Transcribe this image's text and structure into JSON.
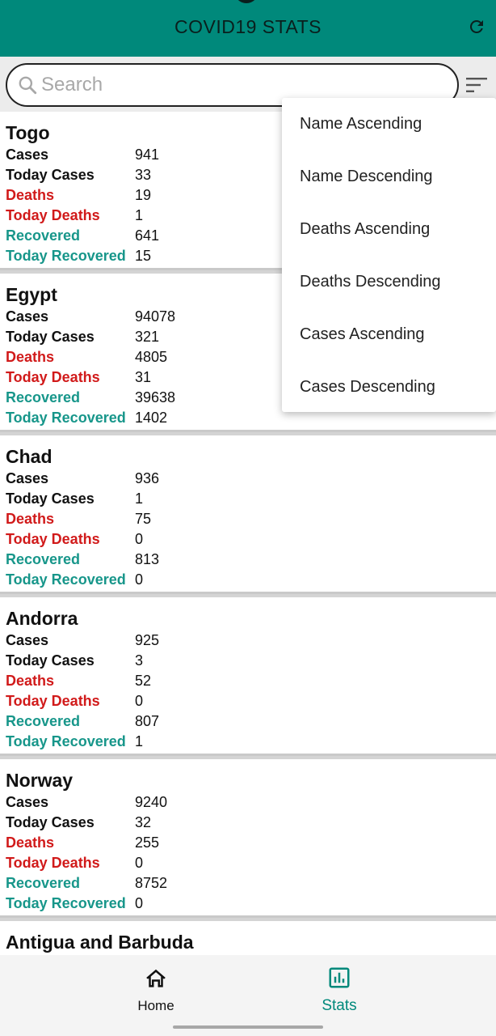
{
  "app": {
    "title": "COVID19 STATS"
  },
  "search": {
    "placeholder": "Search",
    "value": ""
  },
  "labels": {
    "cases": "Cases",
    "today_cases": "Today Cases",
    "deaths": "Deaths",
    "today_deaths": "Today Deaths",
    "recovered": "Recovered",
    "today_recovered": "Today Recovered"
  },
  "countries": [
    {
      "name": "Togo",
      "cases": "941",
      "today_cases": "33",
      "deaths": "19",
      "today_deaths": "1",
      "recovered": "641",
      "today_recovered": "15"
    },
    {
      "name": "Egypt",
      "cases": "94078",
      "today_cases": "321",
      "deaths": "4805",
      "today_deaths": "31",
      "recovered": "39638",
      "today_recovered": "1402"
    },
    {
      "name": "Chad",
      "cases": "936",
      "today_cases": "1",
      "deaths": "75",
      "today_deaths": "0",
      "recovered": "813",
      "today_recovered": "0"
    },
    {
      "name": "Andorra",
      "cases": "925",
      "today_cases": "3",
      "deaths": "52",
      "today_deaths": "0",
      "recovered": "807",
      "today_recovered": "1"
    },
    {
      "name": "Norway",
      "cases": "9240",
      "today_cases": "32",
      "deaths": "255",
      "today_deaths": "0",
      "recovered": "8752",
      "today_recovered": "0"
    },
    {
      "name": "Antigua and Barbuda"
    }
  ],
  "sort_menu": [
    "Name Ascending",
    "Name Descending",
    "Deaths Ascending",
    "Deaths Descending",
    "Cases Ascending",
    "Cases Descending"
  ],
  "nav": {
    "home": "Home",
    "stats": "Stats",
    "active": "stats"
  },
  "colors": {
    "primary": "#00897b",
    "deaths": "#d11a1a",
    "recovered": "#17968a"
  },
  "icons": {
    "refresh": "refresh-icon",
    "search": "search-icon",
    "sort": "sort-icon",
    "home": "home-icon",
    "stats": "stats-icon"
  }
}
